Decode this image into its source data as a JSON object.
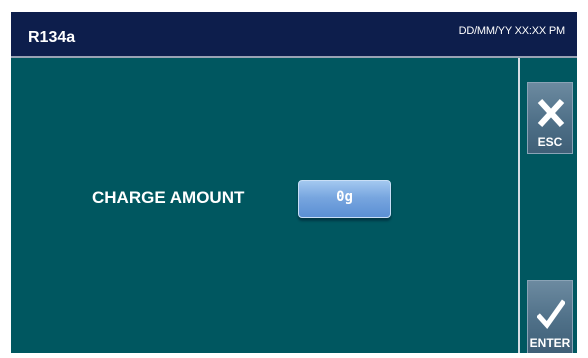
{
  "header": {
    "title": "R134a",
    "datetime": "DD/MM/YY XX:XX PM"
  },
  "main": {
    "field_label": "CHARGE AMOUNT",
    "charge_value": "0g"
  },
  "side_buttons": {
    "esc_label": "ESC",
    "esc_icon": "close-icon",
    "enter_label": "ENTER",
    "enter_icon": "checkmark-icon"
  },
  "colors": {
    "background": "#005760",
    "header": "#0d1e4c",
    "value_button": "#78a6df",
    "side_button": "#4f7088",
    "text": "#ffffff"
  }
}
